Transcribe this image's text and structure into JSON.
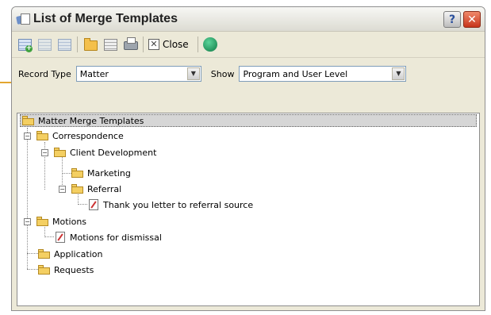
{
  "window": {
    "title": "List of Merge Templates"
  },
  "toolbar": {
    "close_label": "Close",
    "icons": [
      "new-template-icon",
      "edit-template-icon",
      "delete-template-icon",
      "folder-icon",
      "list-icon",
      "print-icon",
      "close-icon",
      "help-icon"
    ]
  },
  "filters": {
    "record_type_label": "Record Type",
    "record_type_value": "Matter",
    "show_label": "Show",
    "show_value": "Program and User Level"
  },
  "tree": {
    "root": "Matter Merge Templates",
    "correspondence": "Correspondence",
    "client_development": "Client Development",
    "marketing": "Marketing",
    "referral": "Referral",
    "thank_you": "Thank you letter to referral source",
    "motions": "Motions",
    "motions_dismissal": "Motions for dismissal",
    "application": "Application",
    "requests": "Requests"
  },
  "colors": {
    "accent": "#e3a62f",
    "window_bg": "#ece9d8",
    "folder": "#f4cf62"
  }
}
